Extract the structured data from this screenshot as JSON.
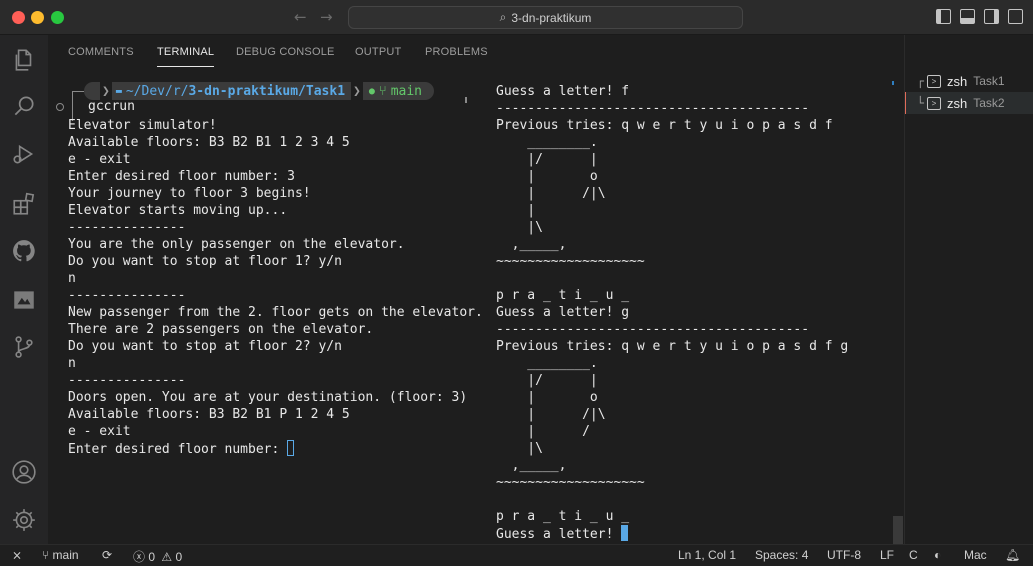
{
  "window": {
    "title": "3-dn-praktikum"
  },
  "panel": {
    "tabs": [
      "COMMENTS",
      "TERMINAL",
      "DEBUG CONSOLE",
      "OUTPUT",
      "PROBLEMS"
    ],
    "active_tab": "TERMINAL"
  },
  "prompt": {
    "path_prefix": "~/Dev/r/",
    "path_bold": "3-dn-praktikum/Task1",
    "branch": "main",
    "command": "gccrun"
  },
  "left_terminal": [
    "Elevator simulator!",
    "Available floors: B3 B2 B1 1 2 3 4 5",
    "e - exit",
    "Enter desired floor number: 3",
    "Your journey to floor 3 begins!",
    "Elevator starts moving up...",
    "---------------",
    "You are the only passenger on the elevator.",
    "Do you want to stop at floor 1? y/n",
    "n",
    "---------------",
    "New passenger from the 2. floor gets on the elevator.",
    "There are 2 passengers on the elevator.",
    "Do you want to stop at floor 2? y/n",
    "n",
    "---------------",
    "Doors open. You are at your destination. (floor: 3)",
    "Available floors: B3 B2 B1 P 1 2 4 5",
    "e - exit",
    "Enter desired floor number: "
  ],
  "right_terminal": [
    "Guess a letter! f",
    "----------------------------------------",
    "Previous tries: q w e r t y u i o p a s d f",
    "    ________.",
    "    |/      |",
    "    |       o",
    "    |      /|\\",
    "    |",
    "    |\\",
    "  ,_____,",
    "~~~~~~~~~~~~~~~~~~~",
    "",
    "p r a _ t i _ u _",
    "Guess a letter! g",
    "----------------------------------------",
    "Previous tries: q w e r t y u i o p a s d f g",
    "    ________.",
    "    |/      |",
    "    |       o",
    "    |      /|\\",
    "    |      /",
    "    |\\",
    "  ,_____,",
    "~~~~~~~~~~~~~~~~~~~",
    "",
    "p r a _ t i _ u _",
    "Guess a letter! "
  ],
  "terminal_list": [
    {
      "name": "zsh",
      "task": "Task1"
    },
    {
      "name": "zsh",
      "task": "Task2"
    }
  ],
  "statusbar": {
    "branch": "main",
    "errors": "0",
    "warnings": "0",
    "position": "Ln 1, Col 1",
    "spaces": "Spaces: 4",
    "encoding": "UTF-8",
    "eol": "LF",
    "language": "C",
    "platform": "Mac"
  }
}
